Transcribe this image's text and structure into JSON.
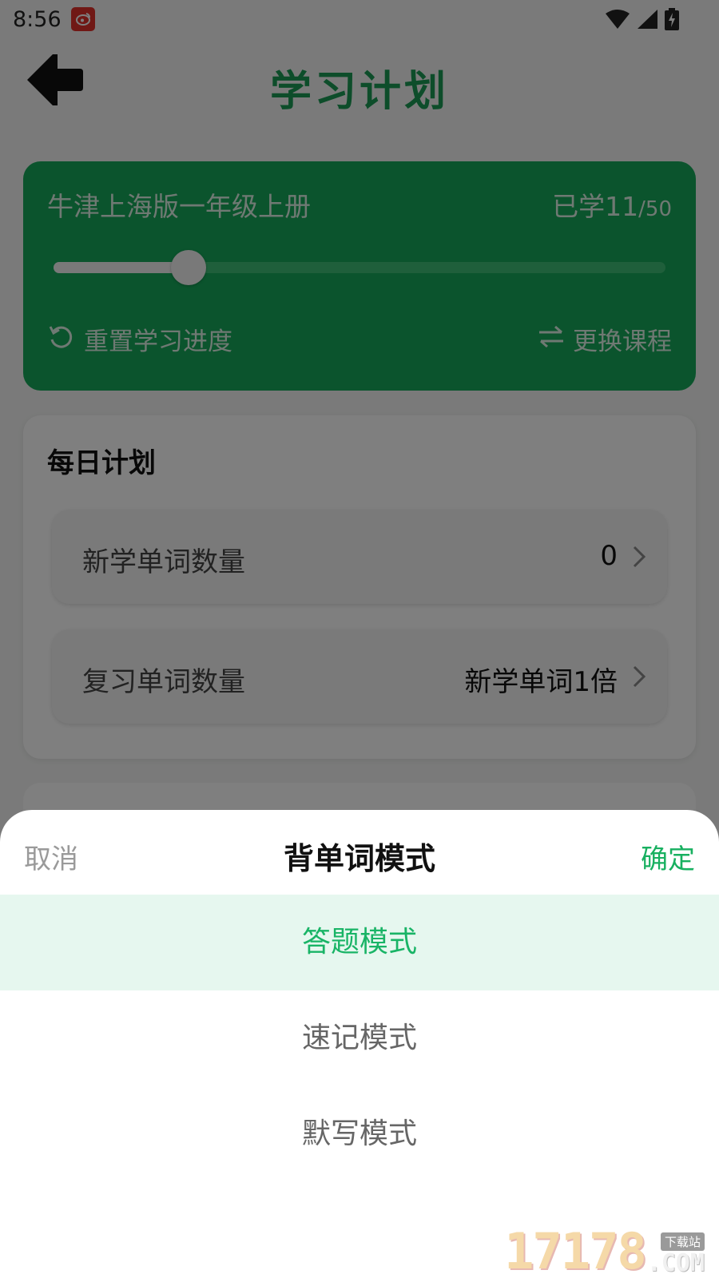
{
  "status_bar": {
    "time": "8:56",
    "icons": [
      "weibo-icon",
      "wifi-icon",
      "signal-icon",
      "battery-charging-icon"
    ]
  },
  "header": {
    "title": "学习计划",
    "back_icon": "arrow-left-icon"
  },
  "course_card": {
    "course_name": "牛津上海版一年级上册",
    "progress_prefix": "已学",
    "learned": "11",
    "total": "/50",
    "progress_fraction": 0.22,
    "reset_label": "重置学习进度",
    "change_label": "更换课程"
  },
  "daily_plan": {
    "title": "每日计划",
    "rows": [
      {
        "label": "新学单词数量",
        "value": "0"
      },
      {
        "label": "复习单词数量",
        "value": "新学单词1倍"
      }
    ]
  },
  "sheet": {
    "cancel_label": "取消",
    "title": "背单词模式",
    "confirm_label": "确定",
    "options": [
      {
        "label": "答题模式",
        "selected": true
      },
      {
        "label": "速记模式",
        "selected": false
      },
      {
        "label": "默写模式",
        "selected": false
      }
    ]
  },
  "watermark": {
    "digits": "17178",
    "tag": "下载站",
    "suffix": ".COM"
  },
  "colors": {
    "brand_green": "#16a85a",
    "title_green": "#1a9a55",
    "selected_bg": "#e6f7ef",
    "selected_text": "#19b466"
  }
}
